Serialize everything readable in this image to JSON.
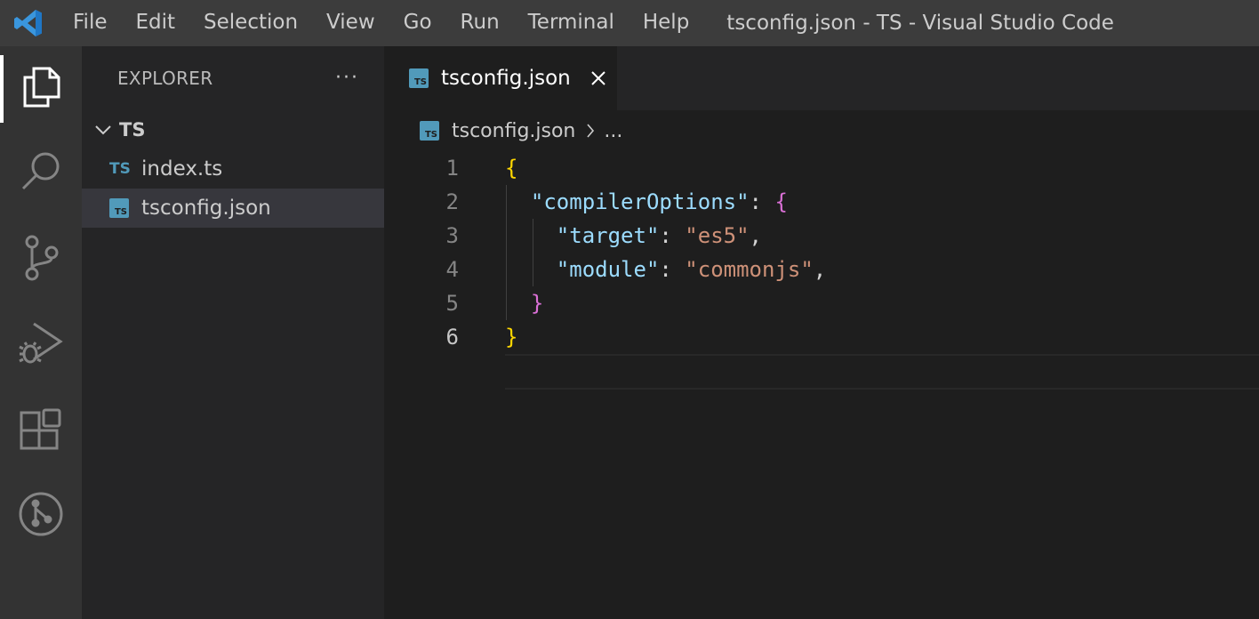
{
  "titlebar": {
    "menu": [
      "File",
      "Edit",
      "Selection",
      "View",
      "Go",
      "Run",
      "Terminal",
      "Help"
    ],
    "window_title": "tsconfig.json - TS - Visual Studio Code"
  },
  "activitybar": {
    "icons": [
      "files-icon",
      "search-icon",
      "source-control-icon",
      "run-debug-icon",
      "extensions-icon",
      "git-graph-icon"
    ]
  },
  "sidebar": {
    "title": "EXPLORER",
    "more": "···",
    "folder": "TS",
    "files": [
      {
        "icon_text": "TS",
        "name": "index.ts"
      },
      {
        "icon_text": "TS",
        "name": "tsconfig.json"
      }
    ]
  },
  "editor": {
    "tab_label": "tsconfig.json",
    "breadcrumb": {
      "file": "tsconfig.json",
      "more": "..."
    },
    "line_numbers": [
      "1",
      "2",
      "3",
      "4",
      "5",
      "6"
    ],
    "code": {
      "l1_brace": "{",
      "l2_key": "\"compilerOptions\"",
      "l2_colon": ": ",
      "l2_brace": "{",
      "l3_key": "\"target\"",
      "l3_colon": ": ",
      "l3_val": "\"es5\"",
      "l3_comma": ",",
      "l4_key": "\"module\"",
      "l4_colon": ": ",
      "l4_val": "\"commonjs\"",
      "l4_comma": ",",
      "l5_brace": "}",
      "l6_brace": "}"
    },
    "current_line": "6"
  },
  "colors": {
    "accent": "#0078d4",
    "ts_icon": "#519aba",
    "json_key": "#9cdcfe",
    "json_string": "#ce9178",
    "bracket_level1": "#ffd700",
    "bracket_level2": "#da70d6"
  }
}
